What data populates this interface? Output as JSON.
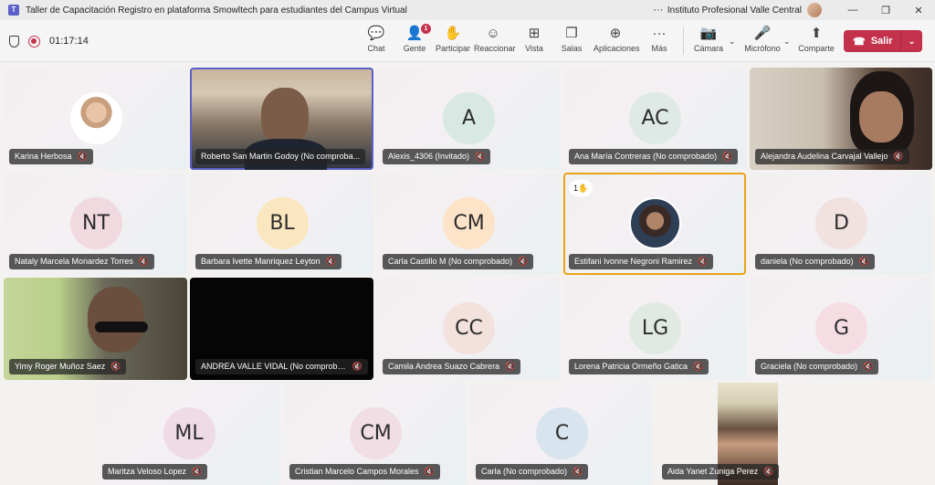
{
  "window": {
    "title": "Taller de Capacitación Registro en plataforma Smowltech para estudiantes del Campus Virtual",
    "more": "···",
    "org": "Instituto Profesional Valle Central",
    "minimize": "—",
    "restore": "❐",
    "close": "✕"
  },
  "meeting": {
    "timer": "01:17:14"
  },
  "toolbar": {
    "chat": "Chat",
    "people": "Gente",
    "people_badge": "1",
    "raise": "Participar",
    "react": "Reaccionar",
    "view": "Vista",
    "rooms": "Salas",
    "apps": "Aplicaciones",
    "more": "Más",
    "camera": "Cámara",
    "mic": "Micrófono",
    "share": "Comparte",
    "leave": "Salir"
  },
  "participants": [
    {
      "name": "Karina Herbosa",
      "initials": "",
      "bg": "#f4ecea"
    },
    {
      "name": "Roberto San Martin Godoy (No comproba...",
      "initials": "",
      "bg": ""
    },
    {
      "name": "Alexis_4306 (Invitado)",
      "initials": "A",
      "bg": "#d8e9e3"
    },
    {
      "name": "Ana María Contreras (No comprobado)",
      "initials": "AC",
      "bg": "#dfe9e5"
    },
    {
      "name": "Alejandra Audelina Carvajal Vallejo",
      "initials": "",
      "bg": ""
    },
    {
      "name": "Nataly Marcela Monardez Torres",
      "initials": "NT",
      "bg": "#f0d9df"
    },
    {
      "name": "Barbara Ivette Manriquez Leyton",
      "initials": "BL",
      "bg": "#fbe7bf"
    },
    {
      "name": "Carla Castillo M (No comprobado)",
      "initials": "CM",
      "bg": "#fde3c8"
    },
    {
      "name": "Estifani Ivonne Negroni Ramirez",
      "initials": "",
      "bg": "#3a3a3a",
      "hand": "1✋"
    },
    {
      "name": "daniela (No comprobado)",
      "initials": "D",
      "bg": "#f1e2e0"
    },
    {
      "name": "Yimy Roger Muñoz Saez",
      "initials": "",
      "bg": ""
    },
    {
      "name": "ANDREA VALLE VIDAL (No comproba...",
      "initials": "",
      "bg": ""
    },
    {
      "name": "Camila Andrea Suazo Cabrera",
      "initials": "CC",
      "bg": "#f2e1dc"
    },
    {
      "name": "Lorena Patricia Ormeño Gatica",
      "initials": "LG",
      "bg": "#e1e9e3"
    },
    {
      "name": "Graciela (No comprobado)",
      "initials": "G",
      "bg": "#f6dde3"
    },
    {
      "name": "Maritza Veloso Lopez",
      "initials": "ML",
      "bg": "#efdbe6"
    },
    {
      "name": "Cristian Marcelo Campos Morales",
      "initials": "CM",
      "bg": "#f1dde4"
    },
    {
      "name": "Carla (No comprobado)",
      "initials": "C",
      "bg": "#d8e4ee"
    },
    {
      "name": "Aida Yanet Zuniga Perez",
      "initials": "",
      "bg": ""
    }
  ]
}
